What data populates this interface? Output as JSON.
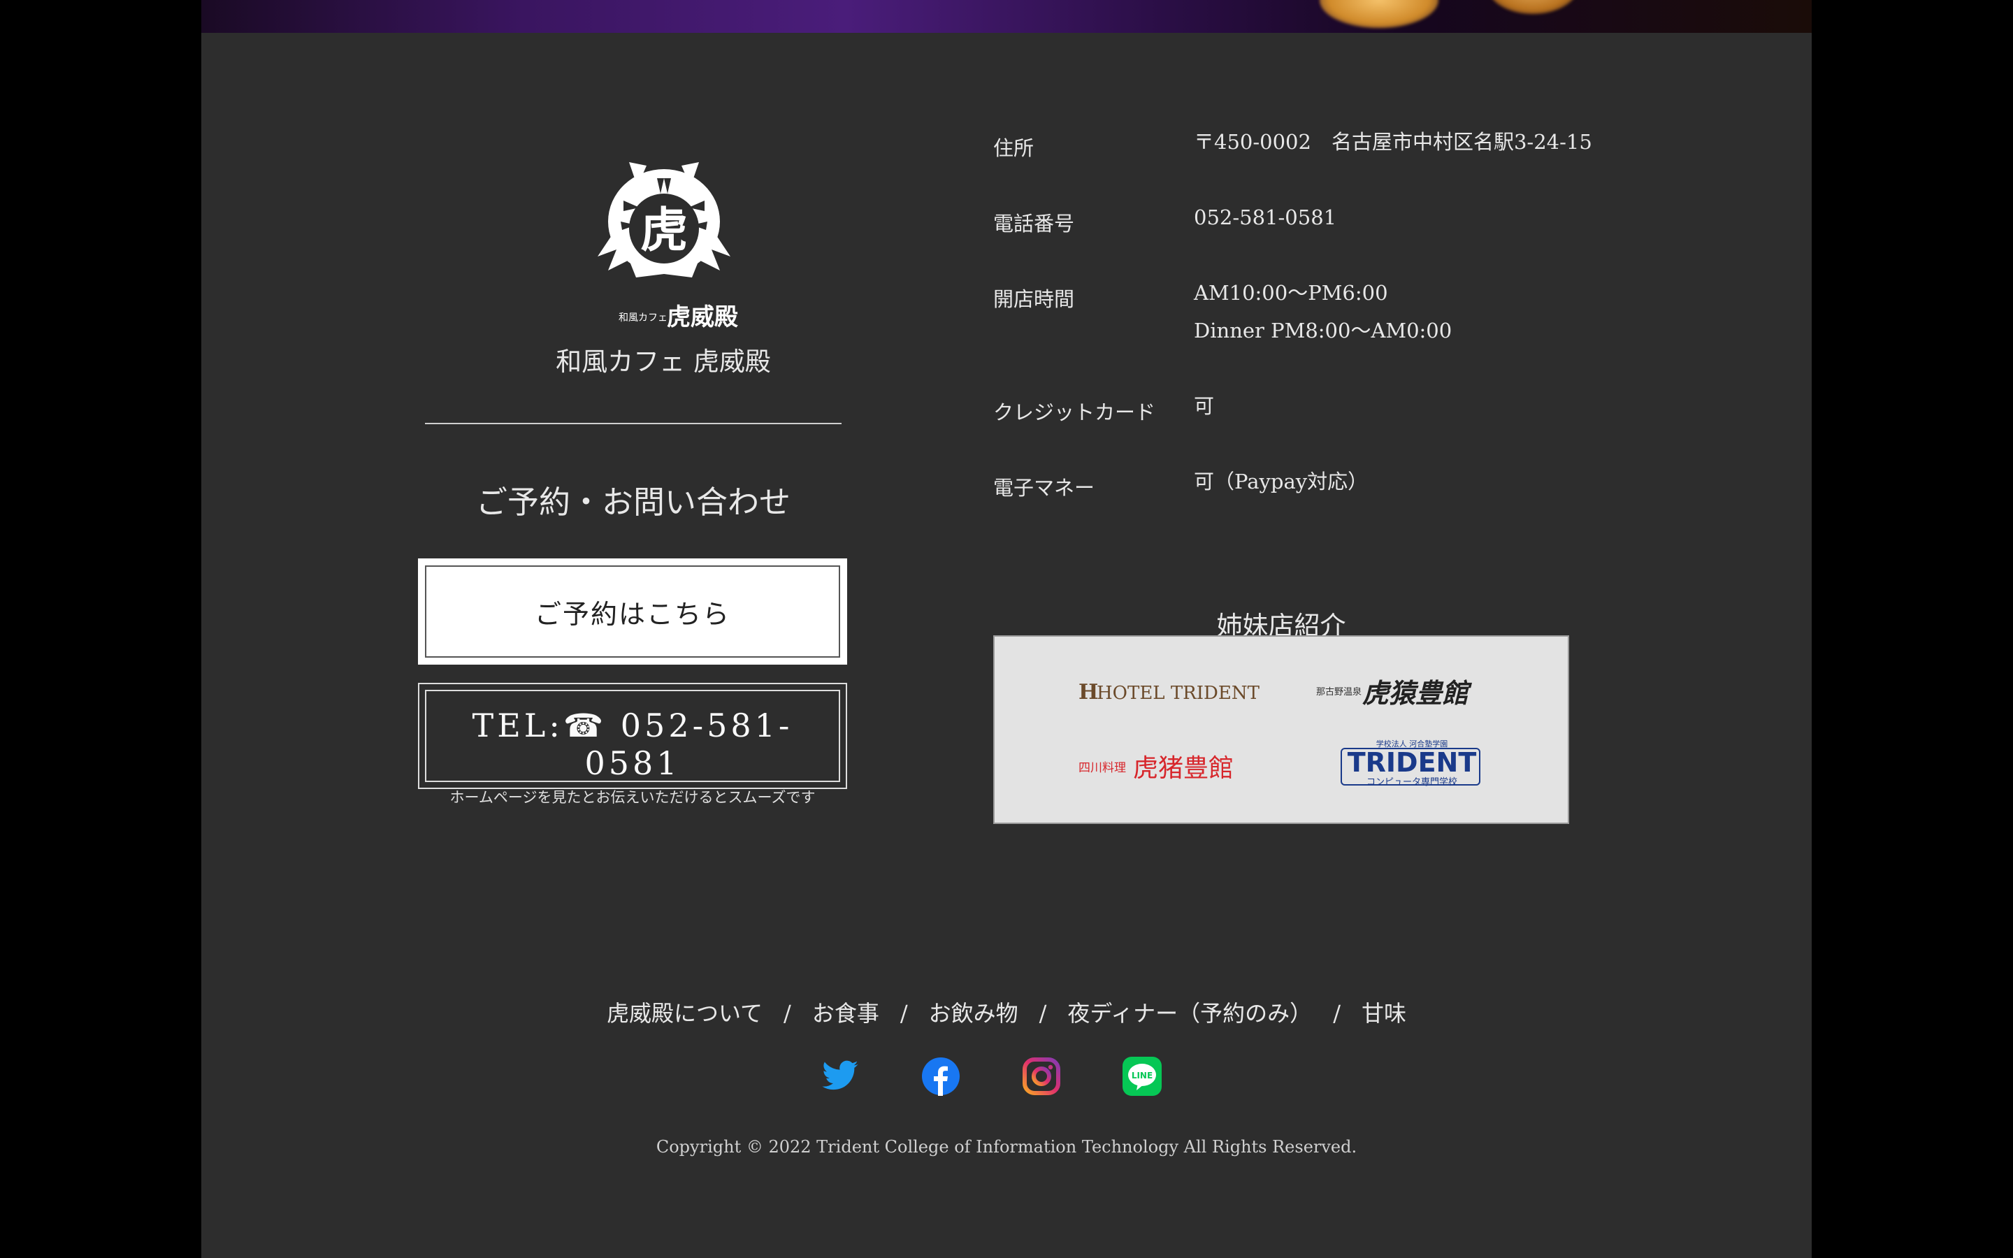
{
  "store": {
    "logo_kanji": "虎",
    "logo_small": "和風カフェ",
    "logo_name": "虎威殿",
    "name": "和風カフェ 虎威殿"
  },
  "contact": {
    "title": "ご予約・お問い合わせ",
    "reserve_label": "ご予約はこちら",
    "tel_prefix": "TEL:",
    "tel_icon": "☎",
    "tel_number": "052-581-0581",
    "tel_note": "ホームページを見たとお伝えいただけるとスムーズです"
  },
  "info": [
    {
      "label": "住所",
      "value": "〒450-0002　名古屋市中村区名駅3-24-15"
    },
    {
      "label": "電話番号",
      "value": "052-581-0581"
    },
    {
      "label": "開店時間",
      "value": "AM10:00〜PM6:00",
      "value2": "Dinner PM8:00〜AM0:00"
    },
    {
      "label": "クレジットカード",
      "value": "可"
    },
    {
      "label": "電子マネー",
      "value": "可（Paypay対応）"
    }
  ],
  "sister": {
    "title": "姉妹店紹介",
    "shops": [
      {
        "name": "HOTEL TRIDENT",
        "mark": "H"
      },
      {
        "small": "那古野温泉",
        "name": "虎猿豊館"
      },
      {
        "small": "四川料理",
        "name": "虎猪豊館"
      },
      {
        "small": "学校法人 河合塾学園",
        "name": "TRIDENT",
        "sub": "コンピュータ専門学校"
      }
    ]
  },
  "nav": {
    "items": [
      "虎威殿について",
      "お食事",
      "お飲み物",
      "夜ディナー（予約のみ）",
      "甘味"
    ],
    "separator": "/"
  },
  "social": [
    "twitter-icon",
    "facebook-icon",
    "instagram-icon",
    "line-icon"
  ],
  "social_text": {
    "line": "LINE"
  },
  "colors": {
    "footer_bg": "#2d2d2d",
    "twitter": "#1d9bf0",
    "facebook": "#1877f2",
    "line": "#06c755",
    "hotel": "#6b4a2a",
    "sichuan": "#d7262b",
    "trident": "#1a3a8a"
  },
  "copyright": "Copyright © 2022 Trident College of Information Technology All Rights Reserved."
}
